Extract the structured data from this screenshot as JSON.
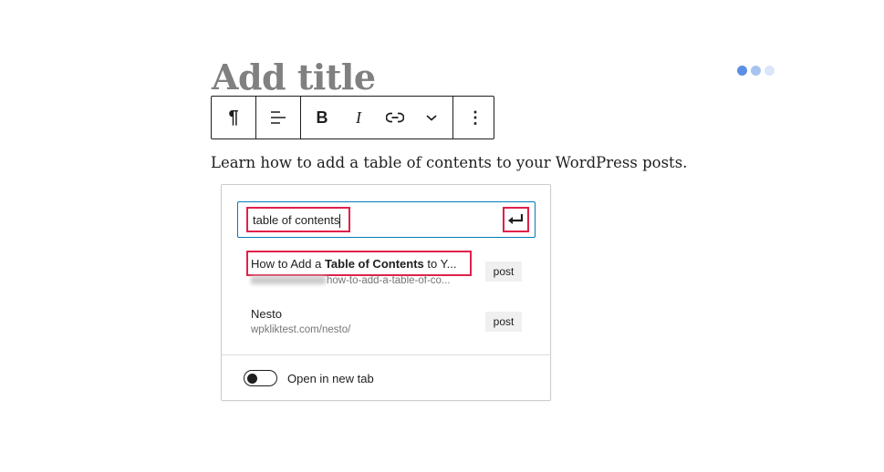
{
  "editor": {
    "title_placeholder": "Add title",
    "paragraph": "Learn how to add a table of contents to your WordPress posts."
  },
  "toolbar": {
    "paragraph": "paragraph-icon",
    "align": "align-icon",
    "bold": "B",
    "italic": "I",
    "link": "link-icon",
    "more_rich": "chevron-down-icon",
    "options": "more-vertical-icon"
  },
  "link_popover": {
    "search_value": "table of contents",
    "results": [
      {
        "title_pre": "How to Add a ",
        "title_bold": "Table of Contents",
        "title_post": " to Y...",
        "url": "how-to-add-a-table-of-co...",
        "type": "post"
      },
      {
        "title_pre": "Nesto",
        "title_bold": "",
        "title_post": "",
        "url": "wpkliktest.com/nesto/",
        "type": "post"
      }
    ],
    "open_new_tab_label": "Open in new tab",
    "open_new_tab_checked": false
  },
  "colors": {
    "accent": "#007cba",
    "highlight": "#e0204a",
    "dots": [
      "#5b8fe6",
      "#a9c3f0",
      "#dbe6fa"
    ]
  }
}
